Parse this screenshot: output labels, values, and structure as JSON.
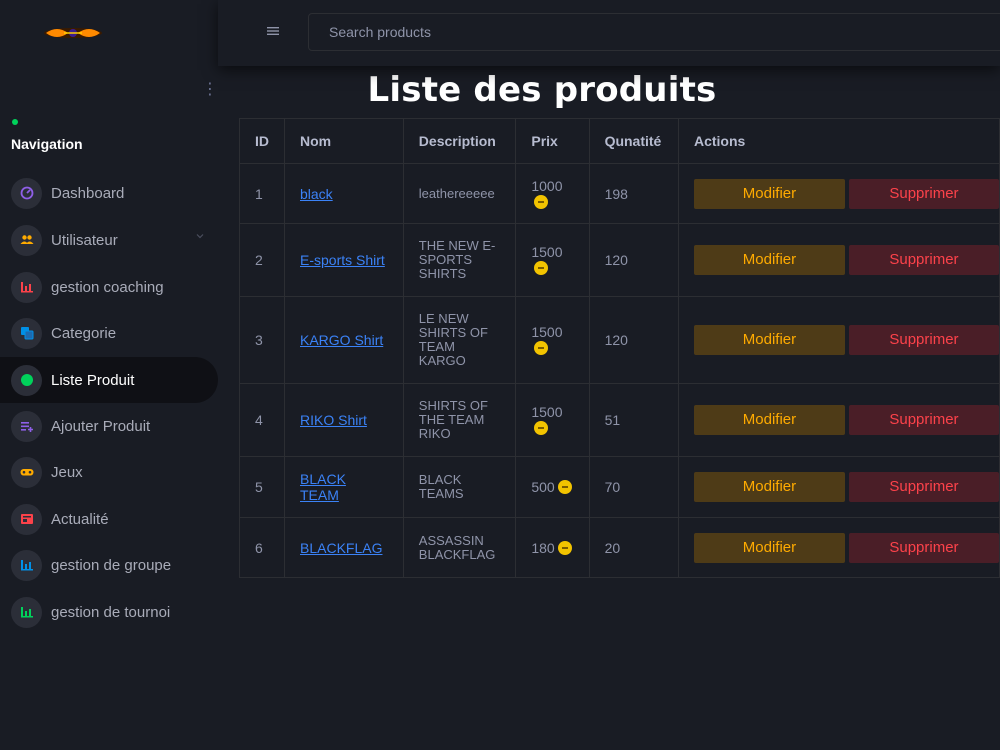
{
  "search": {
    "placeholder": "Search products"
  },
  "sidebar": {
    "category": "Navigation",
    "items": [
      {
        "label": "Dashboard",
        "icon": "speedometer-icon",
        "color": "#8f5fe8"
      },
      {
        "label": "Utilisateur",
        "icon": "users-icon",
        "color": "#ffab00"
      },
      {
        "label": "gestion coaching",
        "icon": "bar-chart-icon",
        "color": "#fc424a"
      },
      {
        "label": "Categorie",
        "icon": "layers-icon",
        "color": "#0090e7"
      },
      {
        "label": "Liste Produit",
        "icon": "dot-icon",
        "color": "#00d25b"
      },
      {
        "label": "Ajouter Produit",
        "icon": "playlist-add-icon",
        "color": "#8f5fe8"
      },
      {
        "label": "Jeux",
        "icon": "gamepad-icon",
        "color": "#ffab00"
      },
      {
        "label": "Actualité",
        "icon": "newspaper-icon",
        "color": "#fc424a"
      },
      {
        "label": "gestion de groupe",
        "icon": "bar-chart-icon",
        "color": "#0090e7"
      },
      {
        "label": "gestion de tournoi",
        "icon": "bar-chart-icon",
        "color": "#00d25b"
      }
    ]
  },
  "page": {
    "title": "Liste des produits"
  },
  "table": {
    "headers": [
      "ID",
      "Nom",
      "Description",
      "Prix",
      "Qunatité",
      "Actions"
    ],
    "edit_label": "Modifier",
    "delete_label": "Supprimer",
    "rows": [
      {
        "id": "1",
        "name": "black",
        "desc": "leathereeeee",
        "price": "1000",
        "qty": "198"
      },
      {
        "id": "2",
        "name": "E-sports Shirt",
        "desc": "THE NEW E-SPORTS SHIRTS",
        "price": "1500",
        "qty": "120"
      },
      {
        "id": "3",
        "name": "KARGO Shirt",
        "desc": "LE NEW SHIRTS OF TEAM KARGO",
        "price": "1500",
        "qty": "120"
      },
      {
        "id": "4",
        "name": "RIKO Shirt",
        "desc": "SHIRTS OF THE TEAM RIKO",
        "price": "1500",
        "qty": "51"
      },
      {
        "id": "5",
        "name": "BLACK TEAM",
        "desc": "BLACK TEAMS",
        "price": "500",
        "qty": "70"
      },
      {
        "id": "6",
        "name": "BLACKFLAG",
        "desc": "ASSASSIN BLACKFLAG",
        "price": "180",
        "qty": "20"
      }
    ]
  }
}
